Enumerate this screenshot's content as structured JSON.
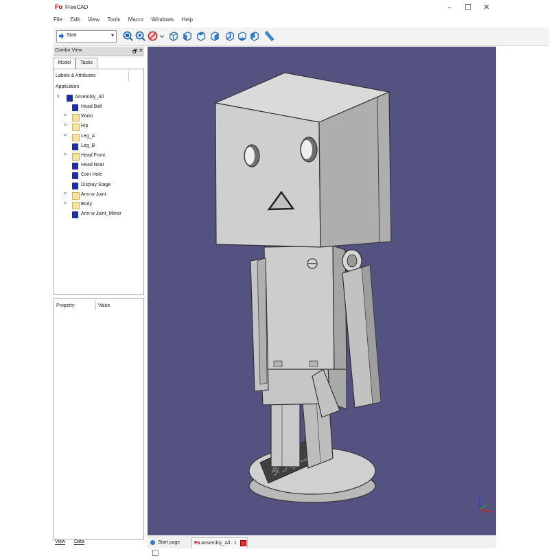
{
  "window": {
    "logo": "Fo",
    "title": "FreeCAD",
    "minimize": "–",
    "maximize": "☐",
    "close": "✕"
  },
  "menu": [
    "File",
    "Edit",
    "View",
    "Tools",
    "Macro",
    "Windows",
    "Help"
  ],
  "toolbar": {
    "workbench": "Start",
    "dropdown_arrow": "▾",
    "buttons": [
      "view-fit-all",
      "view-fit-selection",
      "draw-style",
      "axonometric",
      "front",
      "top",
      "right",
      "rear",
      "bottom",
      "left",
      "measure"
    ]
  },
  "combo_view": {
    "title": "Combo View",
    "float_icon": "🗗",
    "close_icon": "✕",
    "tabs": [
      "Model",
      "Tasks"
    ],
    "tree_header": "Labels & Attributes",
    "section": "Application",
    "root": {
      "label": "Assembly_All",
      "expander": "v"
    },
    "items": [
      {
        "label": "Head Ball",
        "type": "part",
        "expander": ""
      },
      {
        "label": "Waist",
        "type": "folder",
        "expander": ">"
      },
      {
        "label": "Hip",
        "type": "folder",
        "expander": ">"
      },
      {
        "label": "Leg_A",
        "type": "folder",
        "expander": ">"
      },
      {
        "label": "Leg_B",
        "type": "part",
        "expander": ""
      },
      {
        "label": "Head Front",
        "type": "folder",
        "expander": ">"
      },
      {
        "label": "Head Rear",
        "type": "part",
        "expander": ""
      },
      {
        "label": "Coin Hole",
        "type": "part",
        "expander": ""
      },
      {
        "label": "Display Stage",
        "type": "part",
        "expander": ""
      },
      {
        "label": "Arm w Joint",
        "type": "folder",
        "expander": ">"
      },
      {
        "label": "Body",
        "type": "folder",
        "expander": ">"
      },
      {
        "label": "Arm w Joint_Mirror",
        "type": "part",
        "expander": ""
      }
    ]
  },
  "properties": {
    "col_property": "Property",
    "col_value": "Value",
    "tabs": [
      "View",
      "Data"
    ]
  },
  "viewport": {
    "background": "#545281",
    "base_text": "ダンボー"
  },
  "document_tabs": [
    {
      "label": "Start page",
      "active": false
    },
    {
      "label": "Assembly_All : 1",
      "active": true
    }
  ],
  "colors": {
    "part_icon": "#1a2fa8",
    "folder_icon": "#f7e39a",
    "model_gray": "#c8c8c8"
  }
}
